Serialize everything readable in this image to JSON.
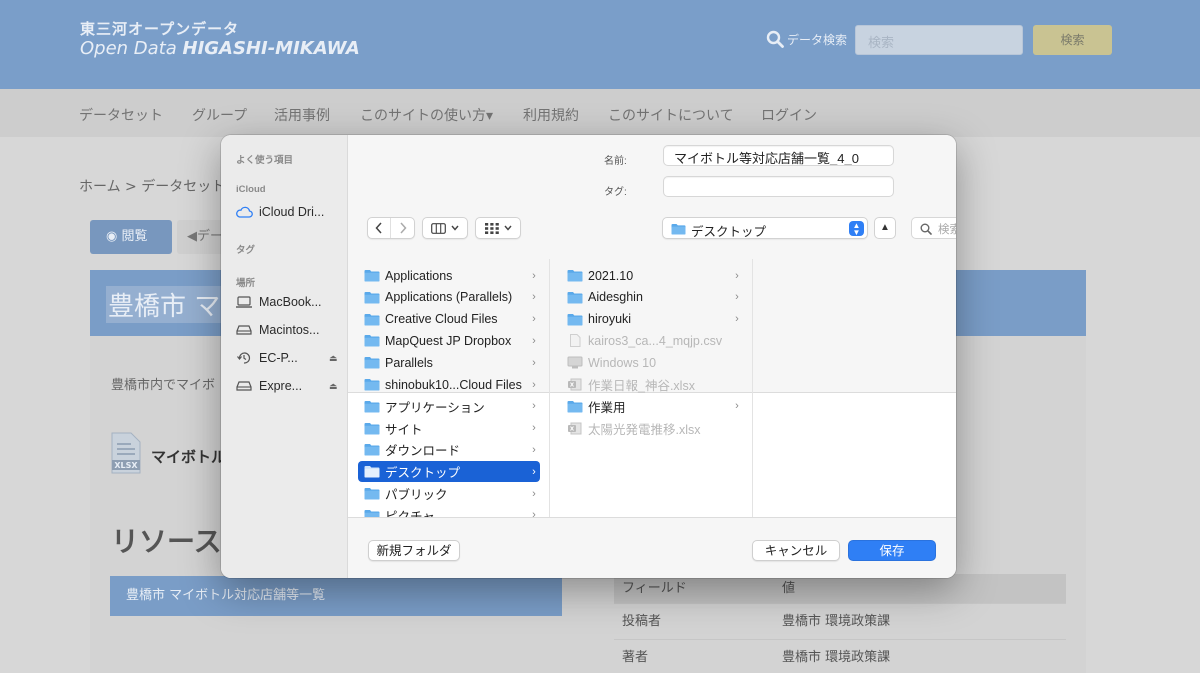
{
  "site": {
    "logo_jp": "東三河オープンデータ",
    "logo_en_prefix": "Open Data ",
    "logo_en_bold": "HIGASHI-MIKAWA",
    "search_label": "データ検索",
    "search_placeholder": "検索",
    "search_button": "検索",
    "nav": [
      "データセット",
      "グループ",
      "活用事例",
      "このサイトの使い方▾",
      "利用規約",
      "このサイトについて",
      "ログイン"
    ],
    "breadcrumb": "ホーム > データセット",
    "view_button": "閲覧",
    "back_button": "◀デー",
    "title": "豊橋市 マ",
    "description": "豊橋市内でマイボ",
    "file_icon_label": "XLSX",
    "file_name": "マイボトル",
    "resources_heading": "リソース",
    "resource_button": "豊橋市 マイボトル対応店舗等一覧",
    "table": {
      "headers": [
        "フィールド",
        "値"
      ],
      "rows": [
        [
          "投稿者",
          "豊橋市 環境政策課"
        ],
        [
          "著者",
          "豊橋市 環境政策課"
        ]
      ]
    }
  },
  "dialog": {
    "sidebar": {
      "favorites_heading": "よく使う項目",
      "icloud_heading": "iCloud",
      "icloud_items": [
        {
          "label": "iCloud Dri...",
          "icon": "cloud-icon"
        }
      ],
      "tags_heading": "タグ",
      "locations_heading": "場所",
      "locations": [
        {
          "label": "MacBook...",
          "icon": "laptop-icon"
        },
        {
          "label": "Macintos...",
          "icon": "drive-icon"
        },
        {
          "label": "EC-P...",
          "icon": "time-machine-icon"
        },
        {
          "label": "Expre...",
          "icon": "drive-icon"
        }
      ]
    },
    "name_label": "名前:",
    "name_value": "マイボトル等対応店舗一覧_4_0",
    "tags_label": "タグ:",
    "tags_value": "",
    "location": "デスクトップ",
    "search_placeholder": "検索",
    "column1": [
      {
        "name": "Applications",
        "type": "folder",
        "arrow": true
      },
      {
        "name": "Applications (Parallels)",
        "type": "folder",
        "arrow": true
      },
      {
        "name": "Creative Cloud Files",
        "type": "folder",
        "arrow": true
      },
      {
        "name": "MapQuest JP Dropbox",
        "type": "folder",
        "arrow": true
      },
      {
        "name": "Parallels",
        "type": "folder",
        "arrow": true
      },
      {
        "name": "shinobuk10...Cloud Files",
        "type": "folder",
        "arrow": true
      },
      {
        "name": "アプリケーション",
        "type": "folder",
        "arrow": true
      },
      {
        "name": "サイト",
        "type": "folder",
        "arrow": true
      },
      {
        "name": "ダウンロード",
        "type": "folder",
        "arrow": true
      },
      {
        "name": "デスクトップ",
        "type": "folder",
        "arrow": true,
        "selected": true
      },
      {
        "name": "パブリック",
        "type": "folder",
        "arrow": true
      },
      {
        "name": "ピクチャ",
        "type": "folder",
        "arrow": true
      }
    ],
    "column2": [
      {
        "name": "2021.10",
        "type": "folder",
        "arrow": true
      },
      {
        "name": "Aidesghin",
        "type": "folder",
        "arrow": true
      },
      {
        "name": "hiroyuki",
        "type": "folder",
        "arrow": true
      },
      {
        "name": "kairos3_ca...4_mqjp.csv",
        "type": "doc",
        "disabled": true
      },
      {
        "name": "Windows 10",
        "type": "vm",
        "disabled": true
      },
      {
        "name": "作業日報_神谷.xlsx",
        "type": "xlsx",
        "disabled": true
      },
      {
        "name": "作業用",
        "type": "folder",
        "arrow": true
      },
      {
        "name": "太陽光発電推移.xlsx",
        "type": "xlsx",
        "disabled": true
      }
    ],
    "new_folder_button": "新規フォルダ",
    "cancel_button": "キャンセル",
    "save_button": "保存",
    "colors": {
      "accent": "#2f7ff5",
      "selection": "#1a62d6",
      "folder": "#5aa9ea"
    }
  }
}
